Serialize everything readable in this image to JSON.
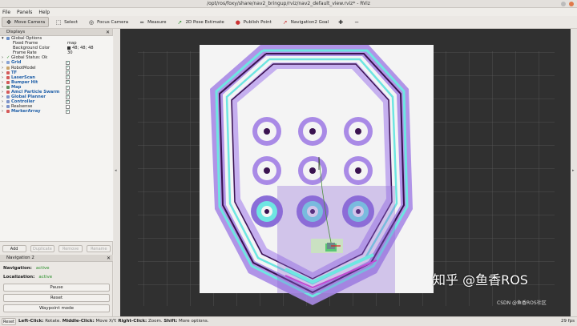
{
  "window": {
    "title": "/opt/ros/foxy/share/nav2_bringup/rviz/nav2_default_view.rviz* - RViz"
  },
  "menu": {
    "items": [
      "File",
      "Panels",
      "Help"
    ]
  },
  "toolbar": {
    "move_camera": "Move Camera",
    "select": "Select",
    "focus_camera": "Focus Camera",
    "measure": "Measure",
    "pose_estimate": "2D Pose Estimate",
    "publish_point": "Publish Point",
    "nav_goal": "Navigation2 Goal"
  },
  "displays": {
    "title": "Displays",
    "global_options": "Global Options",
    "fixed_frame_label": "Fixed Frame",
    "fixed_frame_value": "map",
    "bg_label": "Background Color",
    "bg_value": "48; 48; 48",
    "frame_rate_label": "Frame Rate",
    "frame_rate_value": "30",
    "global_status": "Global Status: Ok",
    "items": [
      "Grid",
      "RobotModel",
      "TF",
      "LaserScan",
      "Bumper Hit",
      "Map",
      "Amcl Particle Swarm",
      "Global Planner",
      "Controller",
      "Realsense",
      "MarkerArray"
    ],
    "add": "Add",
    "duplicate": "Duplicate",
    "remove": "Remove",
    "rename": "Rename"
  },
  "navigation": {
    "title": "Navigation 2",
    "nav_label": "Navigation:",
    "nav_status": "active",
    "loc_label": "Localization:",
    "loc_status": "active",
    "pause": "Pause",
    "reset": "Reset",
    "waypoint": "Waypoint mode"
  },
  "status": {
    "reset": "Reset",
    "hint_left_key": "Left-Click:",
    "hint_left": " Rotate. ",
    "hint_mid_key": "Middle-Click:",
    "hint_mid": " Move X/Y. ",
    "hint_right_key": "Right-Click:",
    "hint_right": " Zoom. ",
    "hint_shift_key": "Shift:",
    "hint_shift": " More options.",
    "fps": "29 fps"
  },
  "watermark": {
    "main": "知乎 @鱼香ROS",
    "sub": "CSDN @鱼香ROS社区"
  },
  "colors": {
    "viewport_bg": "#303030",
    "costmap_purple": "#9d7ae0",
    "costmap_cyan": "#55e0e0",
    "obstacle": "#3a1250",
    "active_green": "#2a8f2a"
  }
}
